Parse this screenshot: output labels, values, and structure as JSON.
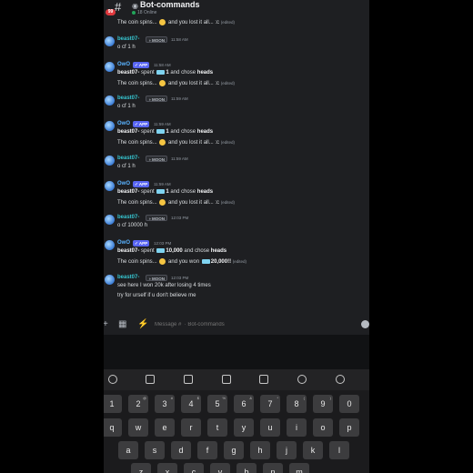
{
  "header": {
    "notification_count": "99",
    "channel_name": "Bot-commands",
    "status": "18 Online"
  },
  "messages": [
    {
      "lines": [
        "The coin spins... | and you lost it all... :c |(edited)"
      ],
      "continuation": true
    },
    {
      "author": "beast07-",
      "tag": "MOON",
      "time": "11:58 AM",
      "lines": [
        "o cf 1 h"
      ]
    },
    {
      "author": "OwO",
      "tag": "APP",
      "time": "11:58 AM",
      "lines": [
        "beast07- spent 1 and chose heads",
        "The coin spins... and you lost it all... :c (edited)"
      ]
    },
    {
      "author": "beast07-",
      "tag": "MOON",
      "time": "11:59 AM",
      "lines": [
        "o cf 1 h"
      ]
    },
    {
      "author": "OwO",
      "tag": "APP",
      "time": "11:59 AM",
      "lines": [
        "beast07- spent 1 and chose heads",
        "The coin spins... and you lost it all... :c (edited)"
      ]
    },
    {
      "author": "beast07-",
      "tag": "MOON",
      "time": "11:59 AM",
      "lines": [
        "o cf 1 h"
      ]
    },
    {
      "author": "OwO",
      "tag": "APP",
      "time": "11:59 AM",
      "lines": [
        "beast07- spent 1 and chose heads",
        "The coin spins... and you lost it all... :c (edited)"
      ]
    },
    {
      "author": "beast07-",
      "tag": "MOON",
      "time": "12:03 PM",
      "lines": [
        "o cf 10000 h"
      ]
    },
    {
      "author": "OwO",
      "tag": "APP",
      "time": "12:03 PM",
      "lines": [
        "beast07- spent 10,000 and chose heads",
        "The coin spins... and you won 20,000!! (edited)"
      ]
    },
    {
      "author": "beast07-",
      "tag": "MOON",
      "time": "12:03 PM",
      "lines": [
        "see here I won 20k after losing 4 times",
        "try for urself if u don't believe me"
      ]
    }
  ],
  "m": {
    "m0_l1a": "The coin spins...",
    "m0_l1b": "and you lost it all... :c",
    "edited": "(edited)",
    "spent": "spent",
    "chose": "and chose",
    "heads": "heads",
    "one": "1",
    "spins": "The coin spins...",
    "lost": "and you lost it all... :c",
    "won": "and you won",
    "won_amt": "20,000!!",
    "ten_k": "10,000",
    "cmd1": "o cf 1 h",
    "cmd2": "o cf 10000 h",
    "chat1": "see here I won 20k after losing 4 times",
    "chat2": "try for urself if u don't believe me",
    "bot": "OwO",
    "user": "beast07-",
    "user_bold": "beast07-",
    "app": "APP",
    "moon": "MOON",
    "t1": "11:58 AM",
    "t2": "11:58 AM",
    "t3": "11:59 AM",
    "t4": "11:59 AM",
    "t5": "11:59 AM",
    "t6": "12:03 PM",
    "t7": "12:03 PM",
    "t8": "12:03 PM"
  },
  "input": {
    "placeholder": "Message #  · Bot-commands"
  },
  "keyboard": {
    "number_row": [
      "1",
      "2",
      "3",
      "4",
      "5",
      "6",
      "7",
      "8",
      "9",
      "0"
    ],
    "number_subs": [
      "",
      "@",
      "#",
      "$",
      "%",
      "&",
      "*",
      "(",
      ")",
      ""
    ],
    "row1": [
      "q",
      "w",
      "e",
      "r",
      "t",
      "y",
      "u",
      "i",
      "o",
      "p"
    ],
    "row2": [
      "a",
      "s",
      "d",
      "f",
      "g",
      "h",
      "j",
      "k",
      "l"
    ],
    "row3_visible": [
      "z",
      "x",
      "c",
      "v",
      "b",
      "n",
      "m"
    ]
  },
  "colors": {
    "background": "#1e1f22",
    "bot_name": "#59b2ff",
    "user_name": "#36c5d0",
    "app_tag": "#5865f2",
    "badge": "#e0393e"
  }
}
